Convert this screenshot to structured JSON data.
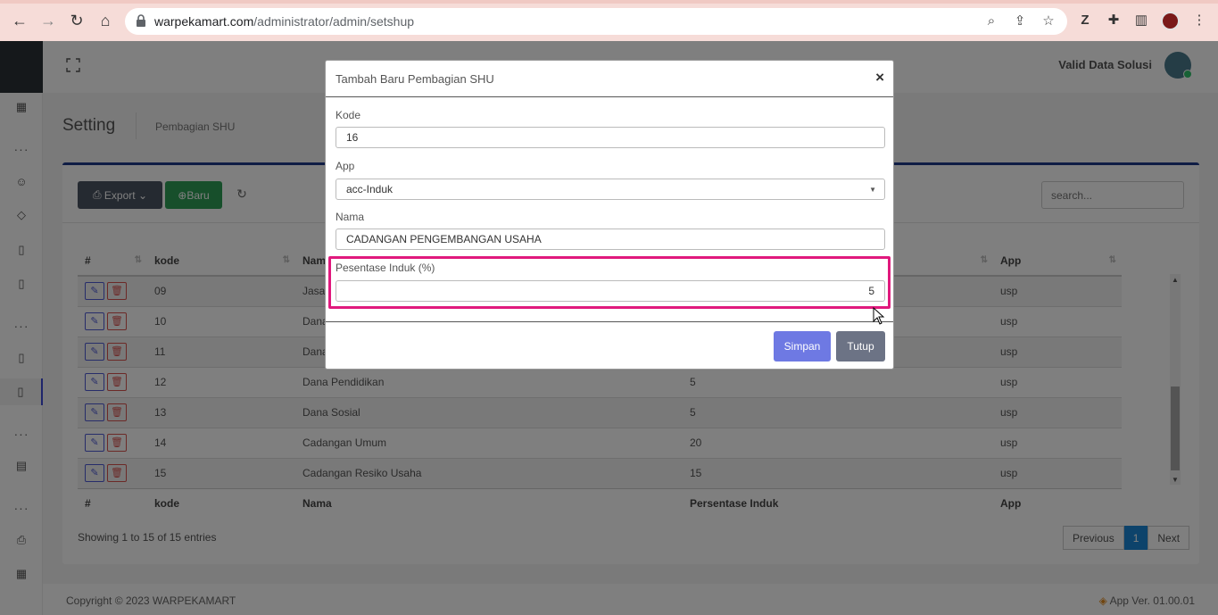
{
  "browser": {
    "url_host": "warpekamart.com",
    "url_path": "/administrator/admin/setshup"
  },
  "topbar": {
    "user_name": "Valid Data Solusi"
  },
  "page": {
    "title": "Setting",
    "breadcrumb": "Pembagian SHU"
  },
  "toolbar": {
    "export_label": "Export",
    "new_label": "Baru",
    "search_placeholder": "search..."
  },
  "table": {
    "columns": [
      "#",
      "kode",
      "Nama",
      "Persentase Induk",
      "App"
    ],
    "rows": [
      {
        "kode": "09",
        "nama": "Jasa",
        "persen": "",
        "app": "usp"
      },
      {
        "kode": "10",
        "nama": "Dana",
        "persen": "",
        "app": "usp"
      },
      {
        "kode": "11",
        "nama": "Dana",
        "persen": "",
        "app": "usp"
      },
      {
        "kode": "12",
        "nama": "Dana Pendidikan",
        "persen": "5",
        "app": "usp"
      },
      {
        "kode": "13",
        "nama": "Dana Sosial",
        "persen": "5",
        "app": "usp"
      },
      {
        "kode": "14",
        "nama": "Cadangan Umum",
        "persen": "20",
        "app": "usp"
      },
      {
        "kode": "15",
        "nama": "Cadangan Resiko Usaha",
        "persen": "15",
        "app": "usp"
      }
    ],
    "header_truncated_nama": "Nam",
    "showing": "Showing 1 to 15 of 15 entries",
    "pager": {
      "previous": "Previous",
      "current": "1",
      "next": "Next"
    }
  },
  "footer": {
    "copyright": "Copyright © 2023 WARPEKAMART",
    "version": "App Ver. 01.00.01"
  },
  "modal": {
    "title": "Tambah Baru Pembagian SHU",
    "close": "×",
    "fields": {
      "kode_label": "Kode",
      "kode_value": "16",
      "app_label": "App",
      "app_value": "acc-Induk",
      "nama_label": "Nama",
      "nama_value": "CADANGAN PENGEMBANGAN USAHA",
      "persen_label": "Pesentase Induk (%)",
      "persen_value": "5"
    },
    "save_label": "Simpan",
    "close_label": "Tutup"
  },
  "colors": {
    "highlight": "#e0197d",
    "primary": "#6e79e3",
    "secondary": "#6c7385",
    "success": "#2f9e57"
  }
}
